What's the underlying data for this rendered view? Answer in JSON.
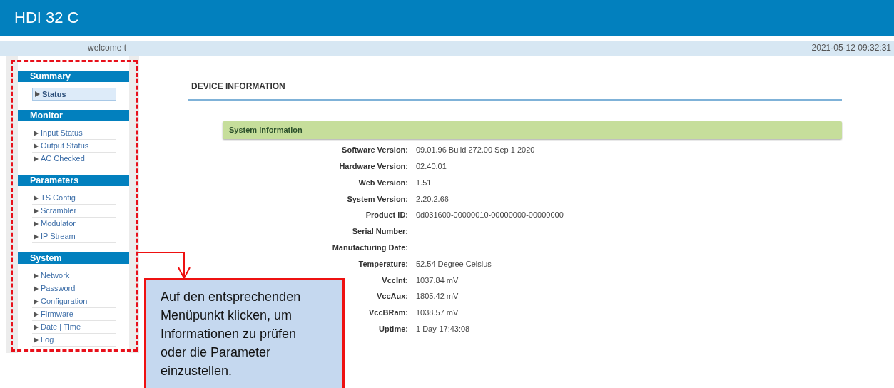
{
  "header": {
    "title": "HDI 32 C"
  },
  "user_bar": {
    "welcome": "welcome t",
    "datetime": "2021-05-12 09:32:31"
  },
  "sidebar": {
    "sections": [
      {
        "title": "Summary",
        "items": [
          {
            "label": "Status",
            "selected": true
          }
        ]
      },
      {
        "title": "Monitor",
        "items": [
          {
            "label": "Input Status",
            "selected": false
          },
          {
            "label": "Output Status",
            "selected": false
          },
          {
            "label": "AC Checked",
            "selected": false
          }
        ]
      },
      {
        "title": "Parameters",
        "items": [
          {
            "label": "TS Config",
            "selected": false
          },
          {
            "label": "Scrambler",
            "selected": false
          },
          {
            "label": "Modulator",
            "selected": false
          },
          {
            "label": "IP Stream",
            "selected": false
          }
        ]
      },
      {
        "title": "System",
        "items": [
          {
            "label": "Network",
            "selected": false
          },
          {
            "label": "Password",
            "selected": false
          },
          {
            "label": "Configuration",
            "selected": false
          },
          {
            "label": "Firmware",
            "selected": false
          },
          {
            "label": "Date | Time",
            "selected": false
          },
          {
            "label": "Log",
            "selected": false
          }
        ]
      }
    ]
  },
  "page_title": "DEVICE INFORMATION",
  "panel": {
    "title": "System Information",
    "rows": [
      {
        "label": "Software Version:",
        "value": "09.01.96 Build 272.00 Sep 1 2020"
      },
      {
        "label": "Hardware Version:",
        "value": "02.40.01"
      },
      {
        "label": "Web Version:",
        "value": "1.51"
      },
      {
        "label": "System Version:",
        "value": "2.20.2.66"
      },
      {
        "label": "Product ID:",
        "value": "0d031600-00000010-00000000-00000000"
      },
      {
        "label": "Serial Number:"
      },
      {
        "label": "Manufacturing Date:"
      },
      {
        "label": "Temperature:",
        "value": "52.54 Degree Celsius"
      },
      {
        "label": "VccInt:",
        "value": "1037.84 mV"
      },
      {
        "label": "VccAux:",
        "value": "1805.42 mV"
      },
      {
        "label": "VccBRam:",
        "value": "1038.57 mV"
      },
      {
        "label": "Uptime:",
        "value": "1 Day-17:43:08"
      }
    ]
  },
  "callout": {
    "text": "Auf den entsprechenden Menüpunkt klicken, um Informationen zu prüfen oder die Parameter einzustellen."
  }
}
